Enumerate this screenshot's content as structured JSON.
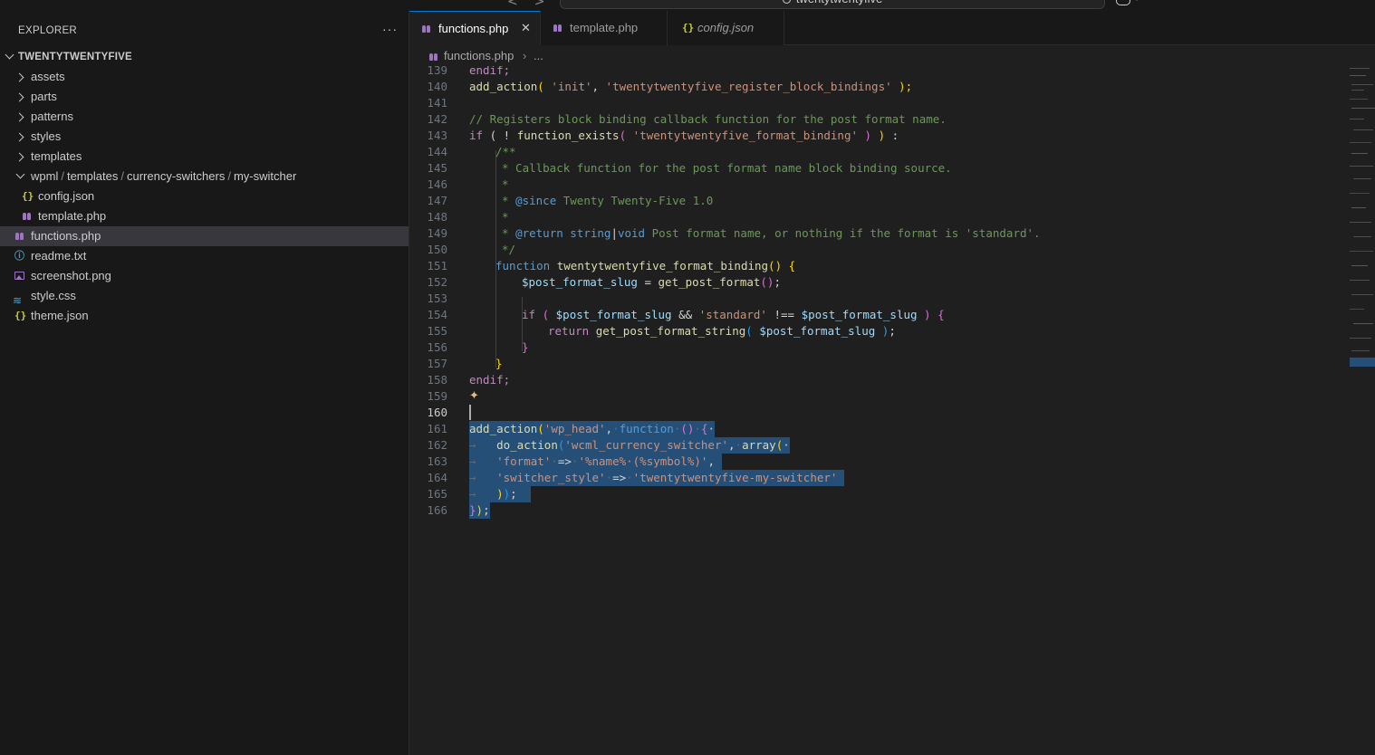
{
  "titlebar": {
    "search_text": "twentytwentyfive",
    "back_glyph": "<",
    "forward_glyph": ">"
  },
  "sidebar": {
    "header": "EXPLORER",
    "more_glyph": "···",
    "root": "TWENTYTWENTYFIVE",
    "folders": [
      "assets",
      "parts",
      "patterns",
      "styles",
      "templates"
    ],
    "open_path": [
      "wpml",
      "templates",
      "currency-switchers",
      "my-switcher"
    ],
    "open_children": [
      "config.json",
      "template.php"
    ],
    "files": [
      "functions.php",
      "readme.txt",
      "screenshot.png",
      "style.css",
      "theme.json"
    ]
  },
  "tabs": [
    {
      "label": "functions.php",
      "icon": "php-icon",
      "active": true
    },
    {
      "label": "template.php",
      "icon": "php-icon",
      "active": false
    },
    {
      "label": "config.json",
      "icon": "json-icon",
      "active": false
    }
  ],
  "breadcrumb": {
    "file": "functions.php",
    "rest": "..."
  },
  "code_lines": [
    {
      "n": "139",
      "text": "endif;"
    },
    {
      "n": "140",
      "text": "add_action( 'init', 'twentytwentyfive_register_block_bindings' );"
    },
    {
      "n": "141",
      "text": ""
    },
    {
      "n": "142",
      "text": "// Registers block binding callback function for the post format name."
    },
    {
      "n": "143",
      "text": "if ( ! function_exists( 'twentytwentyfive_format_binding' ) ) :"
    },
    {
      "n": "144",
      "text": "/**"
    },
    {
      "n": "145",
      "text": "* Callback function for the post format name block binding source."
    },
    {
      "n": "146",
      "text": "*"
    },
    {
      "n": "147",
      "text": "* @since Twenty Twenty-Five 1.0"
    },
    {
      "n": "148",
      "text": "*"
    },
    {
      "n": "149",
      "text": "* @return string|void Post format name, or nothing if the format is 'standard'."
    },
    {
      "n": "150",
      "text": "*/"
    },
    {
      "n": "151",
      "text": "function twentytwentyfive_format_binding() {"
    },
    {
      "n": "152",
      "text": "$post_format_slug = get_post_format();"
    },
    {
      "n": "153",
      "text": ""
    },
    {
      "n": "154",
      "text": "if ( $post_format_slug && 'standard' !== $post_format_slug ) {"
    },
    {
      "n": "155",
      "text": "return get_post_format_string( $post_format_slug );"
    },
    {
      "n": "156",
      "text": "}"
    },
    {
      "n": "157",
      "text": "}"
    },
    {
      "n": "158",
      "text": "endif;"
    },
    {
      "n": "159",
      "text": ""
    },
    {
      "n": "160",
      "text": ""
    },
    {
      "n": "161",
      "text": "add_action('wp_head', function () {"
    },
    {
      "n": "162",
      "text": "do_action('wcml_currency_switcher', array("
    },
    {
      "n": "163",
      "text": "'format' => '%name% (%symbol%)',"
    },
    {
      "n": "164",
      "text": "'switcher_style' => 'twentytwentyfive-my-switcher'"
    },
    {
      "n": "165",
      "text": "));"
    },
    {
      "n": "166",
      "text": "});"
    }
  ],
  "code_tokens": {
    "t140": [
      "add_action",
      "(",
      " ",
      "'init'",
      ", ",
      "'twentytwentyfive_register_block_bindings'",
      " ",
      ");"
    ],
    "t143": [
      "if",
      " ( ! ",
      "function_exists",
      "(",
      " ",
      "'twentytwentyfive_format_binding'",
      " ",
      ")",
      " ",
      ")",
      " :"
    ],
    "t147_tag": "@since",
    "t147_rest": " Twenty Twenty-Five 1.0",
    "t149_tag": "@return",
    "t149_type1": "string",
    "t149_pipe": "|",
    "t149_type2": "void",
    "t149_rest": " Post format name, or nothing if the format is 'standard'.",
    "t151": [
      "function",
      " ",
      "twentytwentyfive_format_binding",
      "()",
      " {"
    ],
    "t152": [
      "$post_format_slug",
      " = ",
      "get_post_format",
      "()",
      ";"
    ],
    "t154": [
      "if",
      " ( ",
      "$post_format_slug",
      " && ",
      "'standard'",
      " !== ",
      "$post_format_slug",
      " ) {"
    ],
    "t155": [
      "return",
      " ",
      "get_post_format_string",
      "(",
      " ",
      "$post_format_slug",
      " ",
      ")",
      ";"
    ],
    "t161": [
      "add_action",
      "(",
      "'wp_head'",
      ",",
      "·",
      "function",
      "·",
      "()",
      "·",
      "{"
    ],
    "t162": [
      "do_action",
      "(",
      "'wcml_currency_switcher'",
      ",",
      "·",
      "array",
      "("
    ],
    "t163": [
      "'format'",
      "·",
      "=>",
      "·",
      "'%name%·(%symbol%)'",
      ","
    ],
    "t164": [
      "'switcher_style'",
      "·",
      "=>",
      "·",
      "'twentytwentyfive-my-switcher'"
    ],
    "t165": [
      ")",
      ")",
      ";"
    ],
    "t166": [
      "}",
      ")",
      ";"
    ],
    "tab_glyph": "→"
  }
}
